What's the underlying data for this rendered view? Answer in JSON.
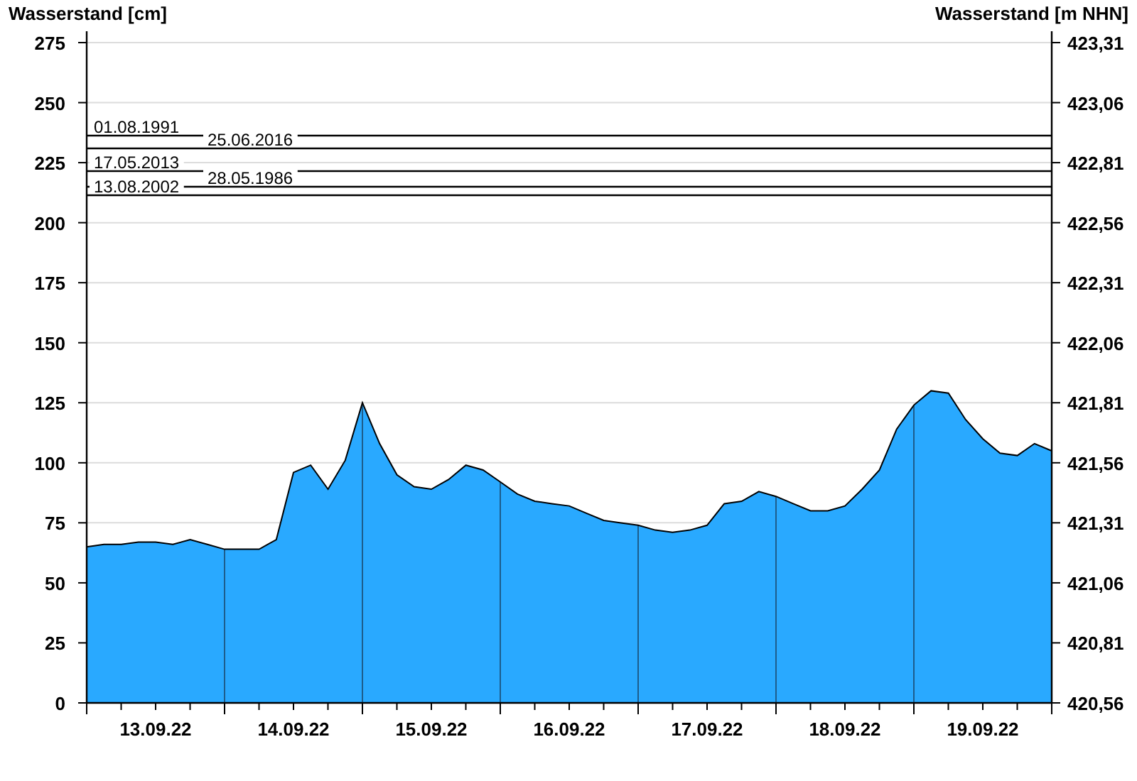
{
  "chart": {
    "chart_data": {
      "type": "area",
      "ylabel": "Wasserstand [cm]",
      "y2label": "Wasserstand [m NHN]",
      "categories": [
        null,
        null,
        null,
        null,
        "13.09.22",
        null,
        null,
        null,
        null,
        null,
        null,
        null,
        "14.09.22",
        null,
        null,
        null,
        null,
        null,
        null,
        null,
        "15.09.22",
        null,
        null,
        null,
        null,
        null,
        null,
        null,
        "16.09.22",
        null,
        null,
        null,
        null,
        null,
        null,
        null,
        "17.09.22",
        null,
        null,
        null,
        null,
        null,
        null,
        null,
        "18.09.22",
        null,
        null,
        null,
        null,
        null,
        null,
        null,
        "19.09.22",
        null,
        null,
        null,
        null
      ],
      "series": [
        {
          "color": "#29a9ff",
          "values": [
            65,
            66,
            66,
            67,
            67,
            66,
            68,
            66,
            64,
            64,
            64,
            68,
            96,
            99,
            89,
            101,
            125,
            108,
            95,
            90,
            89,
            93,
            99,
            97,
            92,
            87,
            84,
            83,
            82,
            79,
            76,
            75,
            74,
            72,
            71,
            72,
            74,
            83,
            84,
            88,
            86,
            83,
            80,
            80,
            82,
            89,
            97,
            114,
            124,
            130,
            129,
            118,
            110,
            104,
            103,
            108,
            105
          ]
        }
      ],
      "ylim": [
        0,
        275
      ],
      "grid": true,
      "y2lim": [
        420.56,
        423.31
      ],
      "yticks": [
        0,
        25,
        50,
        75,
        100,
        125,
        150,
        175,
        200,
        225,
        250,
        275
      ],
      "y2ticks": [
        {
          "value": 420.56,
          "label": "420,56"
        },
        {
          "value": 420.81,
          "label": "420,81"
        },
        {
          "value": 421.06,
          "label": "421,06"
        },
        {
          "value": 421.31,
          "label": "421,31"
        },
        {
          "value": 421.56,
          "label": "421,56"
        },
        {
          "value": 421.81,
          "label": "421,81"
        },
        {
          "value": 422.06,
          "label": "422,06"
        },
        {
          "value": 422.31,
          "label": "422,31"
        },
        {
          "value": 422.56,
          "label": "422,56"
        },
        {
          "value": 422.81,
          "label": "422,81"
        },
        {
          "value": 423.06,
          "label": "423,06"
        },
        {
          "value": 423.31,
          "label": "423,31"
        }
      ],
      "ref_lines": [
        {
          "axis": "y",
          "label": "01.08.1991",
          "value": 236.5
        },
        {
          "axis": "y",
          "label": "25.06.2016",
          "value": 231
        },
        {
          "axis": "y",
          "label": "17.05.2013",
          "value": 222
        },
        {
          "axis": "y",
          "label": "28.05.1986",
          "value": 215
        },
        {
          "axis": "y",
          "label": "13.08.2002",
          "value": 212
        }
      ]
    }
  }
}
